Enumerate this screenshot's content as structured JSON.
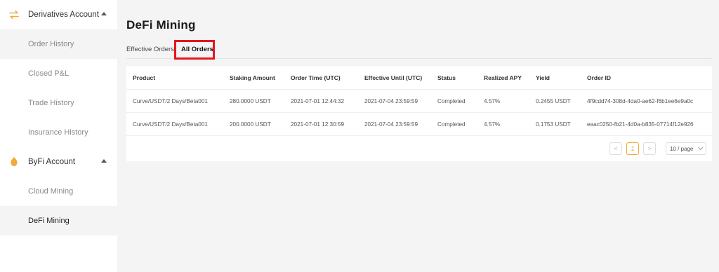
{
  "sidebar": {
    "derivatives": {
      "label": "Derivatives Account",
      "items": [
        "Order History",
        "Closed P&L",
        "Trade History",
        "Insurance History"
      ]
    },
    "byfi": {
      "label": "ByFi Account",
      "items": [
        "Cloud Mining",
        "DeFi Mining"
      ]
    }
  },
  "page": {
    "title": "DeFi Mining"
  },
  "tabs": {
    "effective": "Effective Orders",
    "all": "All Orders"
  },
  "table": {
    "headers": [
      "Product",
      "Staking Amount",
      "Order Time (UTC)",
      "Effective Until (UTC)",
      "Status",
      "Realized APY",
      "Yield",
      "Order ID"
    ],
    "rows": [
      [
        "Curve/USDT/2 Days/Beta001",
        "280.0000 USDT",
        "2021-07-01 12:44:32",
        "2021-07-04 23:59:59",
        "Completed",
        "4.57%",
        "0.2455 USDT",
        "4f9cdd74-308d-4da0-ae62-f6b1ee6e9a0c"
      ],
      [
        "Curve/USDT/2 Days/Beta001",
        "200.0000 USDT",
        "2021-07-01 12:30:59",
        "2021-07-04 23:59:59",
        "Completed",
        "4.57%",
        "0.1753 USDT",
        "eaac0250-fb21-4d0a-b835-07714f12e926"
      ]
    ]
  },
  "pagination": {
    "prev": "<",
    "page": "1",
    "next": ">",
    "page_size": "10 / page"
  },
  "colors": {
    "accent": "#f3a93b",
    "highlight": "#e8141c"
  }
}
